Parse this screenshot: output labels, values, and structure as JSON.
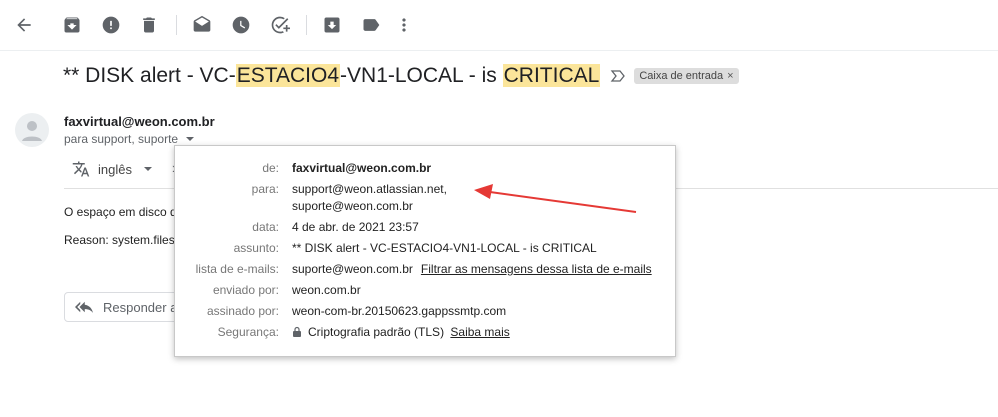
{
  "toolbar": {
    "icons": [
      "back-arrow-icon",
      "archive-icon",
      "report-spam-icon",
      "delete-icon",
      "mark-unread-icon",
      "snooze-icon",
      "add-task-icon",
      "move-to-icon",
      "label-icon",
      "more-vert-icon"
    ]
  },
  "subject": {
    "part1": "** DISK alert - VC-",
    "hl1": "ESTACIO4",
    "part2": "-VN1-LOCAL - is ",
    "hl2": "CRITICAL",
    "label": "Caixa de entrada",
    "label_close": "×"
  },
  "message": {
    "sender": "faxvirtual@weon.com.br",
    "recipients": "para support, suporte",
    "translate_lang": "inglês",
    "body_line1": "O espaço em disco do",
    "body_line2": "Reason: system.filesy",
    "reply_label": "Responder a"
  },
  "details": {
    "from_label": "de:",
    "from_value": "faxvirtual@weon.com.br",
    "to_label": "para:",
    "to_value1": "support@weon.atlassian.net,",
    "to_value2": "suporte@weon.com.br",
    "date_label": "data:",
    "date_value": "4 de abr. de 2021 23:57",
    "subject_label": "assunto:",
    "subject_value": "** DISK alert - VC-ESTACIO4-VN1-LOCAL - is CRITICAL",
    "mailing_list_label": "lista de e-mails:",
    "mailing_list_value": "suporte@weon.com.br",
    "mailing_list_filter": "Filtrar as mensagens dessa lista de e-mails",
    "mailed_by_label": "enviado por:",
    "mailed_by_value": "weon.com.br",
    "signed_by_label": "assinado por:",
    "signed_by_value": "weon-com-br.20150623.gappssmtp.com",
    "security_label": "Segurança:",
    "security_value": "Criptografia padrão (TLS)",
    "security_link": "Saiba mais"
  },
  "colors": {
    "highlight": "#fbe59a",
    "annotation_arrow": "#e53935"
  }
}
